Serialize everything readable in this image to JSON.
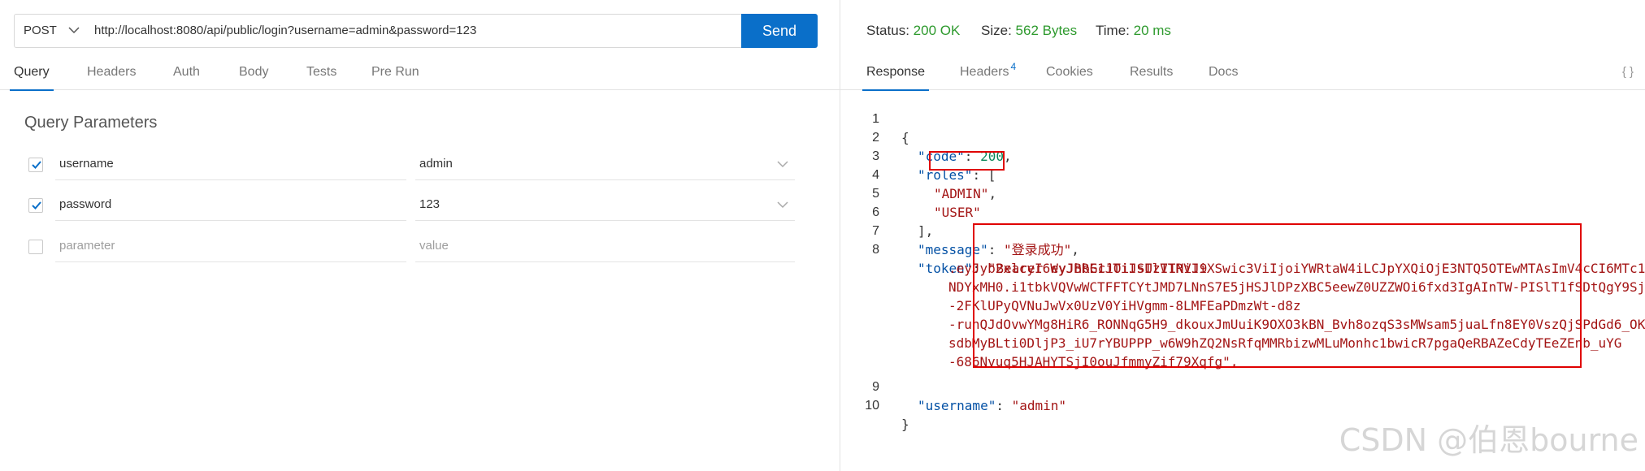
{
  "request": {
    "method": "POST",
    "url": "http://localhost:8080/api/public/login?username=admin&password=123",
    "send_label": "Send"
  },
  "left_tabs": [
    "Query",
    "Headers",
    "Auth",
    "Body",
    "Tests",
    "Pre Run"
  ],
  "query": {
    "title": "Query Parameters",
    "params": [
      {
        "name": "username",
        "value": "admin",
        "checked": true
      },
      {
        "name": "password",
        "value": "123",
        "checked": true
      }
    ],
    "new_param_placeholder": "parameter",
    "new_value_placeholder": "value"
  },
  "response_status": {
    "status_label": "Status:",
    "status_value": "200 OK",
    "size_label": "Size:",
    "size_value": "562 Bytes",
    "time_label": "Time:",
    "time_value": "20 ms"
  },
  "right_tabs": {
    "response": "Response",
    "headers": "Headers",
    "headers_count": "4",
    "cookies": "Cookies",
    "results": "Results",
    "docs": "Docs",
    "format_icon": "{ }"
  },
  "response_body": {
    "line_numbers": [
      "1",
      "2",
      "3",
      "4",
      "5",
      "6",
      "7",
      "8",
      "9",
      "10"
    ],
    "l1": "{",
    "code_key": "\"code\"",
    "code_value": "200",
    "roles_key": "\"roles\"",
    "role_admin": "\"ADMIN\"",
    "role_user": "\"USER\"",
    "roles_close": "],",
    "message_key": "\"message\"",
    "message_value": "\"登录成功\"",
    "token_key": "\"token\"",
    "token_lines": [
      "\"Bearer eyJhbGciOiJSUzI1NiJ9",
      ".eyJyb2xlcyI6WyJBRE1JTiIsIlVTRVIiXSwic3ViIjoiYWRtaW4iLCJpYXQiOjE3NTQ5OTEwMTAsImV4cCI6MTc1",
      "NDYxMH0.i1tbkVQVwWCTFFTCYtJMD7LNnS7E5jHSJlDPzXBC5eewZ0UZZWOi6fxd3IgAInTW-PISlT1fSDtQgY9Sj",
      "-2FKlUPyQVNuJwVx0UzV0YiHVgmm-8LMFEaPDmzWt-d8z",
      "-ruhQJdOvwYMg8HiR6_RONNqG5H9_dkouxJmUuiK9OXO3kBN_Bvh8ozqS3sMWsam5juaLfn8EY0VszQjSPdGd6_OK",
      "sdbMyBLti0DljP3_iU7rYBUPPP_w6W9hZQ2NsRfqMMRbizwMLuMonhc1bwicR7pgaQeRBAZeCdyTEeZEnb_uYG",
      "-686Nvuq5HJAHYTSjI0ouJfmmyZif79Xqfg\","
    ],
    "username_key": "\"username\"",
    "username_value": "\"admin\"",
    "l10": "}"
  },
  "watermark": "CSDN @伯恩bourne",
  "colors": {
    "accent": "#0a6fc9",
    "status_ok": "#2e9a2e",
    "json_key": "#0451a5",
    "json_string": "#a31515",
    "json_number": "#098658",
    "highlight_box": "#e00000"
  }
}
